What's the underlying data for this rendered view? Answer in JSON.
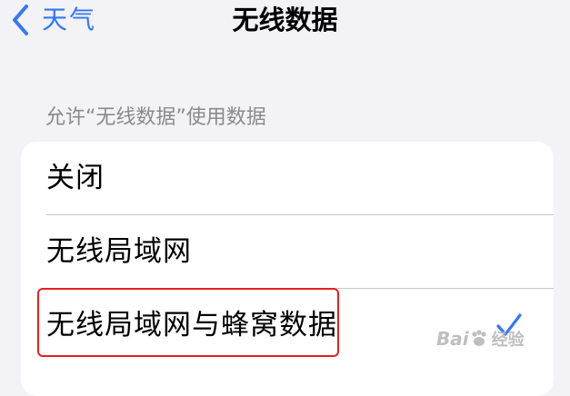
{
  "nav": {
    "back_label": "天气",
    "title": "无线数据"
  },
  "section_header": "允许“无线数据”使用数据",
  "options": [
    {
      "label": "关闭",
      "selected": false
    },
    {
      "label": "无线局域网",
      "selected": false
    },
    {
      "label": "无线局域网与蜂窝数据",
      "selected": true
    }
  ],
  "colors": {
    "accent": "#3478f6",
    "background": "#f2f2f7",
    "annotation_box": "#e8201c"
  },
  "watermark": {
    "text": "Bai",
    "sub": "经验"
  }
}
